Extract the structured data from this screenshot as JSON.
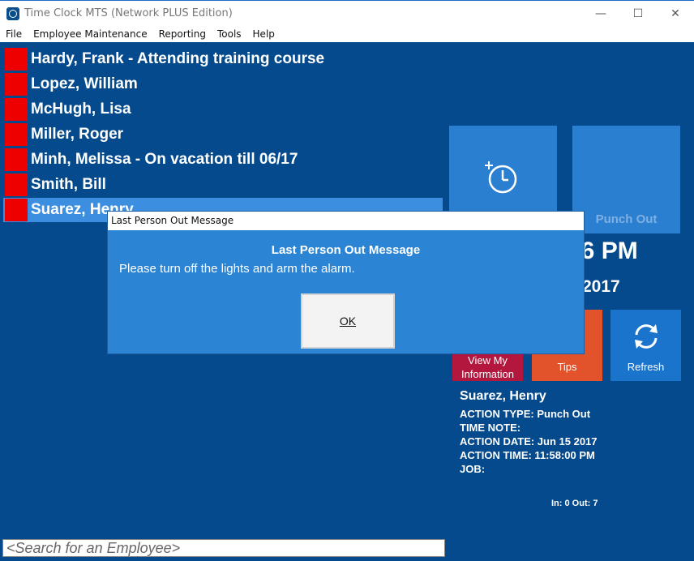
{
  "window": {
    "title": "Time Clock MTS (Network PLUS Edition)",
    "minimize": "—",
    "maximize": "☐",
    "close": "✕"
  },
  "menu": [
    "File",
    "Employee Maintenance",
    "Reporting",
    "Tools",
    "Help"
  ],
  "employees": [
    {
      "name": "Hardy, Frank - Attending training course",
      "status_color": "#ee0000"
    },
    {
      "name": "Lopez, William",
      "status_color": "#ee0000"
    },
    {
      "name": "McHugh, Lisa",
      "status_color": "#ee0000"
    },
    {
      "name": "Miller, Roger",
      "status_color": "#ee0000"
    },
    {
      "name": "Minh, Melissa - On vacation till 06/17",
      "status_color": "#ee0000"
    },
    {
      "name": "Smith, Bill",
      "status_color": "#ee0000"
    },
    {
      "name": "Suarez, Henry",
      "status_color": "#ee0000",
      "selected": true
    }
  ],
  "tiles": {
    "punch_out_label": "Punch Out",
    "view_info_line1": "View My",
    "view_info_line2": "Information",
    "tips_label": "Tips",
    "refresh_label": "Refresh"
  },
  "clock": {
    "time_visible": "06 PM",
    "date_visible": "2017"
  },
  "details": {
    "name": "Suarez, Henry",
    "action_type": "ACTION TYPE: Punch Out",
    "time_note": "TIME NOTE:",
    "action_date": "ACTION DATE: Jun 15 2017",
    "action_time": "ACTION TIME: 11:58:00 PM",
    "job": "JOB:"
  },
  "counts": "In: 0 Out: 7",
  "search": {
    "placeholder": "<Search for an Employee>"
  },
  "dialog": {
    "title": "Last Person Out Message",
    "heading": "Last Person Out Message",
    "message": "Please turn off the lights and arm the alarm.",
    "ok_label": "OK"
  }
}
